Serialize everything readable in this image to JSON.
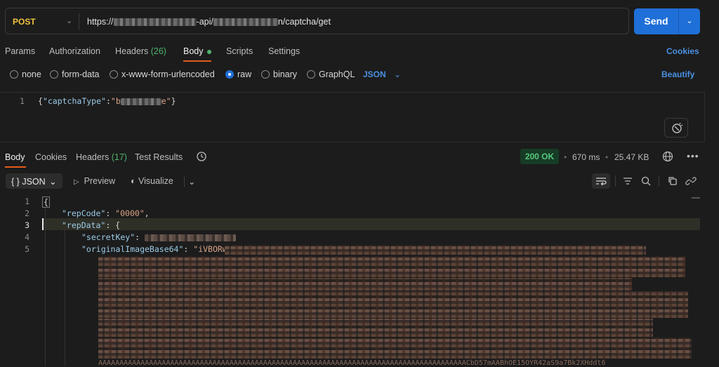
{
  "request": {
    "method": "POST",
    "url_prefix": "https://",
    "url_mid": "-api/",
    "url_suffix": "n/captcha/get",
    "send_label": "Send"
  },
  "request_tabs": {
    "params": "Params",
    "authorization": "Authorization",
    "headers": "Headers",
    "headers_count": "(26)",
    "body": "Body",
    "scripts": "Scripts",
    "settings": "Settings",
    "cookies": "Cookies"
  },
  "body_types": {
    "none": "none",
    "form_data": "form-data",
    "urlencoded": "x-www-form-urlencoded",
    "raw": "raw",
    "binary": "binary",
    "graphql": "GraphQL",
    "format": "JSON",
    "beautify": "Beautify",
    "selected": "raw"
  },
  "editor": {
    "line1_num": "1",
    "line1_open": "{",
    "line1_key": "\"captchaType\"",
    "line1_colon": ":",
    "line1_val_start": "\"b",
    "line1_val_end": "e\"",
    "line1_close": "}"
  },
  "response_tabs": {
    "body": "Body",
    "cookies": "Cookies",
    "headers": "Headers",
    "headers_count": "(17)",
    "test_results": "Test Results"
  },
  "response_meta": {
    "status": "200 OK",
    "time": "670 ms",
    "size": "25.47 KB"
  },
  "response_toolbar": {
    "format": "JSON",
    "preview": "Preview",
    "visualize": "Visualize"
  },
  "response_lines": {
    "l1": "1",
    "l2": "2",
    "l3": "3",
    "l4": "4",
    "l5": "5",
    "open_brace": "{",
    "repCode_key": "\"repCode\"",
    "repCode_val": "\"0000\"",
    "repData_key": "\"repData\"",
    "secretKey_key": "\"secretKey\"",
    "originalImage_key": "\"originalImageBase64\"",
    "originalImage_val_start": "\"iVBORw",
    "tail_text": "AAAAAAAAAAAAAAAAAAAAAAAAAAAAAAAAAAAAAAAAAAAAAAAAAAAAAAAAAAAAAAAAAAAAAAAAAAAAAAAAAAAAAAACbD57mAABhOE15OYR42aS9a7Bk2XHddt6"
  }
}
